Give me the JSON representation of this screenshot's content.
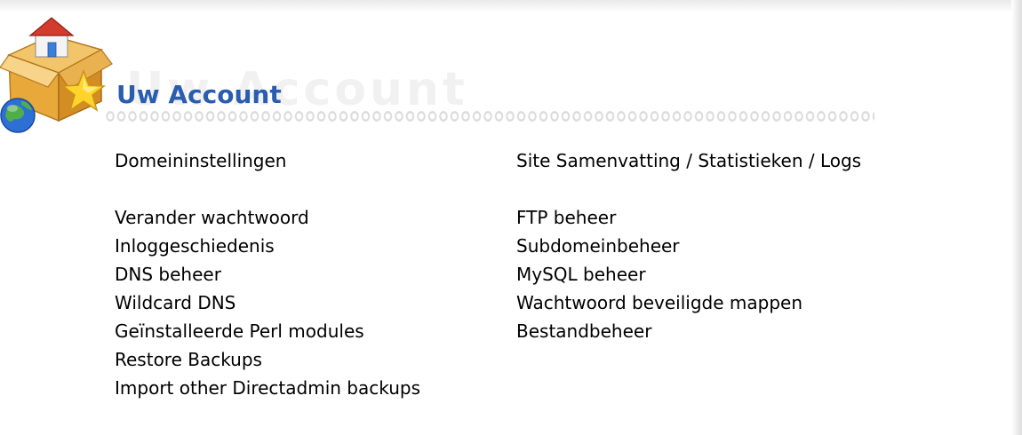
{
  "header": {
    "title": "Uw Account",
    "title_shadow": "Uw Account",
    "icon": "account-box-home-globe-star-icon"
  },
  "colors": {
    "title": "#2a5db0",
    "link": "#000000",
    "background": "#ffffff"
  },
  "left_column": {
    "top_link": "Domeininstellingen",
    "links": [
      "Verander wachtwoord",
      "Inloggeschiedenis",
      "DNS beheer",
      "Wildcard DNS",
      "Geïnstalleerde Perl modules",
      "Restore Backups",
      "Import other Directadmin backups"
    ]
  },
  "right_column": {
    "top_link": "Site Samenvatting / Statistieken / Logs",
    "links": [
      "FTP beheer",
      "Subdomeinbeheer",
      "MySQL beheer",
      "Wachtwoord beveiligde mappen",
      "Bestandbeheer"
    ]
  }
}
